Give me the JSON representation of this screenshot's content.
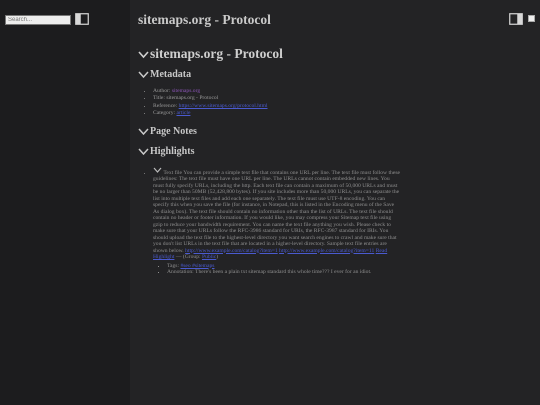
{
  "sidebar": {
    "search_placeholder": "Search..."
  },
  "header": {
    "title": "sitemaps.org - Protocol"
  },
  "page": {
    "title": "sitemaps.org - Protocol",
    "sections": {
      "metadata": "Metadata",
      "page_notes": "Page Notes",
      "highlights": "Highlights"
    }
  },
  "metadata": {
    "author_label": "Author:",
    "author_value": "sitemaps.org",
    "title_label": "Title:",
    "title_value": "sitemaps.org - Protocol",
    "reference_label": "Reference:",
    "reference_value": "https://www.sitemaps.org/protocol.html",
    "category_label": "Category:",
    "category_value": "article"
  },
  "highlights": {
    "text": "Text file You can provide a simple text file that contains one URL per line. The text file must follow these guidelines: The text file must have one URL per line. The URLs cannot contain embedded new lines. You must fully specify URLs, including the http. Each text file can contain a maximum of 50,000 URLs and must be no larger than 50MB (52,428,800 bytes). If you site includes more than 50,000 URLs, you can separate the list into multiple text files and add each one separately. The text file must use UTF-8 encoding. You can specify this when you save the file (for instance, in Notepad, this is listed in the Encoding menu of the Save As dialog box). The text file should contain no information other than the list of URLs. The text file should contain no header or footer information. If you would like, you may compress your Sitemap text file using gzip to reduce your bandwidth requirement. You can name the text file anything you wish. Please check to make sure that your URLs follow the RFC-3986 standard for URIs, the RFC-3987 standard for IRIs. You should upload the text file to the highest-level directory you want search engines to crawl and make sure that you don't list URLs in the text file that are located in a higher-level directory. Sample text file entries are shown below.",
    "link1": "http://www.example.com/catalog?item=1",
    "link2": "http://www.example.com/catalog?item=11",
    "read_more": "Read Highlight",
    "source_prefix": "— (Group:",
    "source_group": "Public",
    "source_suffix": ")",
    "tags_label": "Tags:",
    "tags_value": "#seo #sitemaps",
    "annotation_label": "Annotation:",
    "annotation_text": "There's been a plain txt sitemap standard this whole time??? I ever for an idiot."
  }
}
